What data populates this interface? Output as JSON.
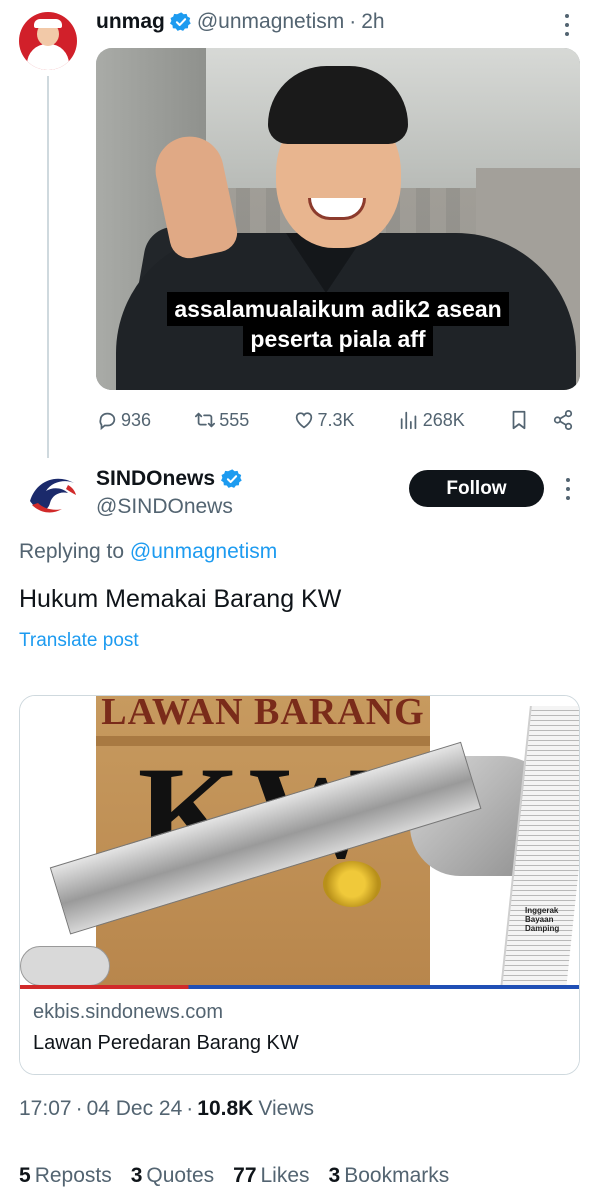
{
  "parent_tweet": {
    "name": "unmag",
    "handle": "@unmagnetism",
    "separator": "·",
    "time": "2h",
    "image_caption_line1": "assalamualaikum adik2 asean",
    "image_caption_line2": "peserta piala aff",
    "replies": "936",
    "reposts": "555",
    "likes": "7.3K",
    "views": "268K"
  },
  "main_tweet": {
    "author_name": "SINDOnews",
    "author_handle": "@SINDOnews",
    "follow_label": "Follow",
    "replying_prefix": "Replying to",
    "replying_handle": "@unmagnetism",
    "text": "Hukum Memakai Barang KW",
    "translate_label": "Translate post",
    "card": {
      "image_headline": "LAWAN BARANG",
      "image_big_text": "KW",
      "image_paper_text": "Inggerak\nBayaan\nDamping",
      "domain": "ekbis.sindonews.com",
      "title": "Lawan Peredaran Barang KW"
    },
    "time": "17:07",
    "date": "04 Dec 24",
    "views_count": "10.8K",
    "views_label": "Views",
    "stats": {
      "reposts_count": "5",
      "reposts_label": "Reposts",
      "quotes_count": "3",
      "quotes_label": "Quotes",
      "likes_count": "77",
      "likes_label": "Likes",
      "bookmarks_count": "3",
      "bookmarks_label": "Bookmarks"
    }
  },
  "colors": {
    "link": "#1d9bf0",
    "secondary_text": "#536471",
    "follow_button": "#0f1419",
    "verified": "#1d9bf0"
  },
  "icons": [
    "verified-badge-icon",
    "more-icon",
    "reply-icon",
    "repost-icon",
    "like-icon",
    "views-icon",
    "bookmark-icon",
    "share-icon"
  ]
}
